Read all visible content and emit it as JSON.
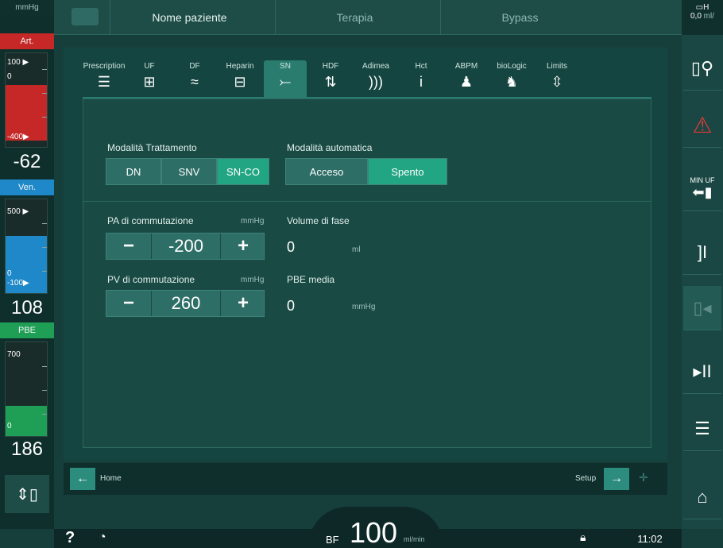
{
  "left": {
    "unit": "mmHg",
    "art_label": "Art.",
    "art_top": "100 ▶",
    "art_zero": "0",
    "art_low": "-400▶",
    "art_value": "-62",
    "ven_label": "Ven.",
    "ven_top": "500 ▶",
    "ven_zero": "0",
    "ven_low": "-100▶",
    "ven_value": "108",
    "pbe_label": "PBE",
    "pbe_top": "700",
    "pbe_zero": "0",
    "pbe_value": "186",
    "colors": {
      "art": "#c62828",
      "ven": "#1e88c8",
      "pbe": "#1f9e55"
    }
  },
  "topbar": {
    "patient": "Nome paziente",
    "therapy": "Terapia",
    "bypass": "Bypass",
    "uf_value": "0,0",
    "uf_unit": "ml/"
  },
  "tabs": [
    {
      "label": "Prescription",
      "icon": "☰"
    },
    {
      "label": "UF",
      "icon": "⊞"
    },
    {
      "label": "DF",
      "icon": "≈"
    },
    {
      "label": "Heparin",
      "icon": "⊟"
    },
    {
      "label": "SN",
      "icon": "⤚"
    },
    {
      "label": "HDF",
      "icon": "⇅"
    },
    {
      "label": "Adimea",
      "icon": ")))"
    },
    {
      "label": "Hct",
      "icon": "i"
    },
    {
      "label": "ABPM",
      "icon": "♟"
    },
    {
      "label": "bioLogic",
      "icon": "♞"
    },
    {
      "label": "Limits",
      "icon": "⇳"
    }
  ],
  "panel": {
    "treatment_mode_label": "Modalità Trattamento",
    "modes": [
      "DN",
      "SNV",
      "SN-CO"
    ],
    "selected_mode": "SN-CO",
    "auto_mode_label": "Modalità automatica",
    "auto_on": "Acceso",
    "auto_off": "Spento",
    "auto_selected": "Spento",
    "pa_label": "PA di commutazione",
    "pa_unit": "mmHg",
    "pa_value": "-200",
    "pv_label": "PV di commutazione",
    "pv_unit": "mmHg",
    "pv_value": "260",
    "phase_label": "Volume di fase",
    "phase_value": "0",
    "phase_unit": "ml",
    "pbe_avg_label": "PBE media",
    "pbe_avg_value": "0",
    "pbe_avg_unit": "mmHg"
  },
  "nav": {
    "home": "Home",
    "setup": "Setup"
  },
  "status": {
    "bf_label": "BF",
    "bf_value": "100",
    "bf_unit": "ml/min",
    "time": "11:02"
  },
  "right": {
    "min_uf": "MIN UF"
  }
}
